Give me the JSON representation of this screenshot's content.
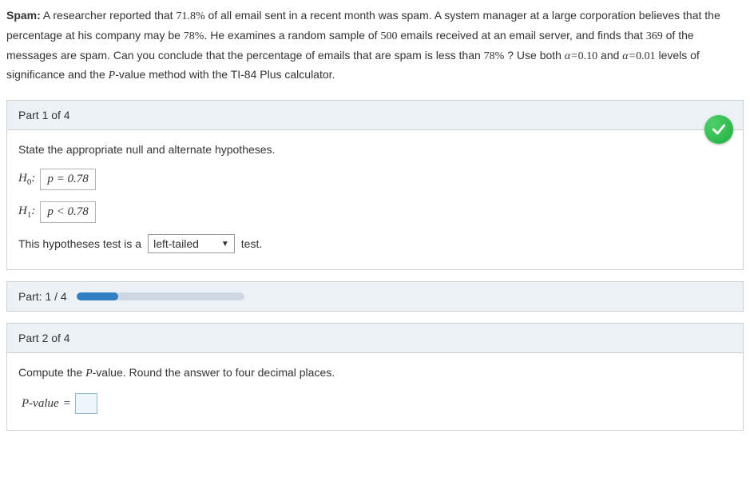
{
  "problem": {
    "label": "Spam:",
    "text_1": " A researcher reported that ",
    "pct1": "71.8%",
    "text_2": " of all email sent in a recent month was spam. A system manager at a large corporation believes that the percentage at his company may be ",
    "pct2": "78%",
    "text_3": ". He examines a random sample of ",
    "n": "500",
    "text_4": " emails received at an email server, and finds that ",
    "x": "369",
    "text_5": " of the messages are spam. Can you conclude that the percentage of emails that are spam is less than ",
    "pct3": "78%",
    "text_6": " ? Use both ",
    "alpha1_lhs": "α=",
    "alpha1_rhs": "0.10",
    "and": " and ",
    "alpha2_lhs": "α=",
    "alpha2_rhs": "0.01",
    "text_7": " levels of significance and the ",
    "pvalue_term": "P",
    "text_8": "-value method with the TI-84 Plus calculator."
  },
  "part1": {
    "header": "Part 1 of 4",
    "prompt": "State the appropriate null and alternate hypotheses.",
    "h0_label": "H",
    "h0_sub": "0",
    "h0_answer": "p = 0.78",
    "h1_label": "H",
    "h1_sub": "1",
    "h1_answer": "p < 0.78",
    "sentence_pre": "This hypotheses test is a",
    "select_value": "left-tailed",
    "sentence_post": "test."
  },
  "progress": {
    "label": "Part: 1 / 4",
    "fraction": 0.25
  },
  "part2": {
    "header": "Part 2 of 4",
    "prompt_pre": "Compute the ",
    "prompt_p": "P",
    "prompt_post": "-value. Round the answer to four decimal places.",
    "pvalue_label": "P-value",
    "eq": "="
  }
}
